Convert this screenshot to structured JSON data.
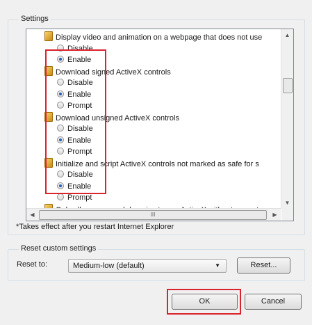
{
  "settings": {
    "group_label": "Settings",
    "items": [
      {
        "type": "category",
        "label": "Display video and animation on a webpage that does not use"
      },
      {
        "type": "option",
        "label": "Disable",
        "checked": false
      },
      {
        "type": "option",
        "label": "Enable",
        "checked": true
      },
      {
        "type": "category",
        "label": "Download signed ActiveX controls"
      },
      {
        "type": "option",
        "label": "Disable",
        "checked": false
      },
      {
        "type": "option",
        "label": "Enable",
        "checked": true
      },
      {
        "type": "option",
        "label": "Prompt",
        "checked": false
      },
      {
        "type": "category",
        "label": "Download unsigned ActiveX controls"
      },
      {
        "type": "option",
        "label": "Disable",
        "checked": false
      },
      {
        "type": "option",
        "label": "Enable",
        "checked": true
      },
      {
        "type": "option",
        "label": "Prompt",
        "checked": false
      },
      {
        "type": "category",
        "label": "Initialize and script ActiveX controls not marked as safe for s"
      },
      {
        "type": "option",
        "label": "Disable",
        "checked": false
      },
      {
        "type": "option",
        "label": "Enable",
        "checked": true
      },
      {
        "type": "option",
        "label": "Prompt",
        "checked": false
      },
      {
        "type": "category",
        "label": "Only allow approved domains to use ActiveX without prompt"
      }
    ],
    "hscroll_thumb_label": "III"
  },
  "note": "*Takes effect after you restart Internet Explorer",
  "reset": {
    "group_title": "Reset custom settings",
    "label": "Reset to:",
    "selected": "Medium-low (default)",
    "button": "Reset..."
  },
  "buttons": {
    "ok": "OK",
    "cancel": "Cancel"
  },
  "colors": {
    "highlight": "#d9232d",
    "radio_selected": "#1f5fbf"
  }
}
